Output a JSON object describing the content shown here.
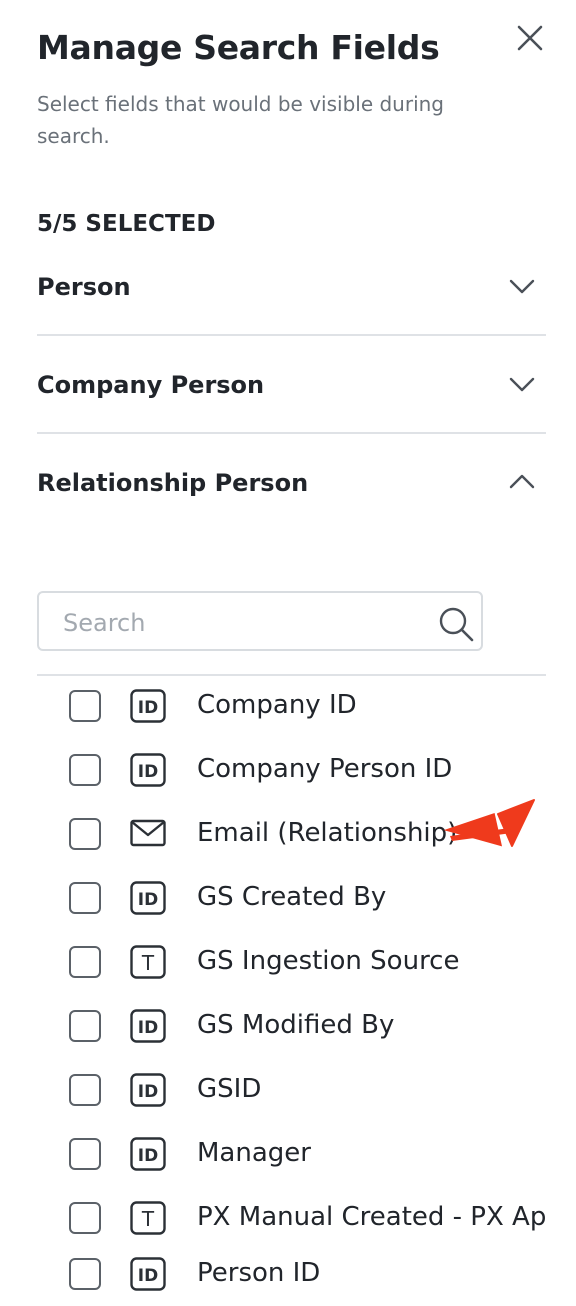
{
  "panel": {
    "title": "Manage Search Fields",
    "subtitle": "Select fields that would be visible during search.",
    "selected_count": "5/5 SELECTED"
  },
  "sections": [
    {
      "label": "Person",
      "expanded": false
    },
    {
      "label": "Company Person",
      "expanded": false
    },
    {
      "label": "Relationship Person",
      "expanded": true
    }
  ],
  "search": {
    "placeholder": "Search",
    "value": ""
  },
  "fields": [
    {
      "label": "Company ID",
      "icon": "id-icon",
      "checked": false
    },
    {
      "label": "Company Person ID",
      "icon": "id-icon",
      "checked": false
    },
    {
      "label": "Email (Relationship)",
      "icon": "envelope-icon",
      "checked": false
    },
    {
      "label": "GS Created By",
      "icon": "id-icon",
      "checked": false
    },
    {
      "label": "GS Ingestion Source",
      "icon": "text-type-icon",
      "checked": false
    },
    {
      "label": "GS Modified By",
      "icon": "id-icon",
      "checked": false
    },
    {
      "label": "GSID",
      "icon": "id-icon",
      "checked": false
    },
    {
      "label": "Manager",
      "icon": "id-icon",
      "checked": false
    },
    {
      "label": "PX Manual Created - PX Ap",
      "icon": "text-type-icon",
      "checked": false
    },
    {
      "label": "Person ID",
      "icon": "id-icon",
      "checked": false
    }
  ],
  "id_icon_text": "ID",
  "text_icon_text": "T",
  "colors": {
    "annotation_arrow": "#ef3a1c",
    "divider": "#dfe2e6",
    "text_primary": "#21252b",
    "text_secondary": "#6a7179"
  }
}
